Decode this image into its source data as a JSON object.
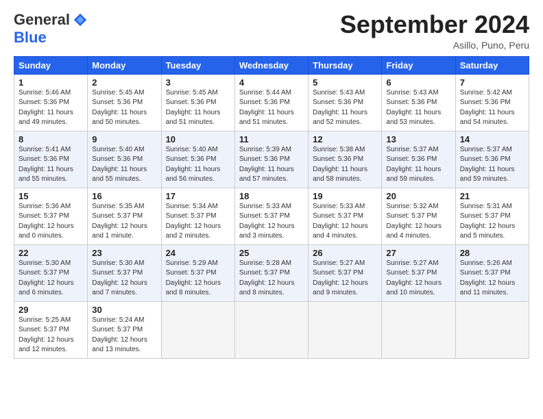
{
  "header": {
    "logo_general": "General",
    "logo_blue": "Blue",
    "month_title": "September 2024",
    "location": "Asillo, Puno, Peru"
  },
  "calendar": {
    "days_of_week": [
      "Sunday",
      "Monday",
      "Tuesday",
      "Wednesday",
      "Thursday",
      "Friday",
      "Saturday"
    ],
    "weeks": [
      [
        {
          "day": "1",
          "sunrise": "5:46 AM",
          "sunset": "5:36 PM",
          "daylight": "11 hours and 49 minutes."
        },
        {
          "day": "2",
          "sunrise": "5:45 AM",
          "sunset": "5:36 PM",
          "daylight": "11 hours and 50 minutes."
        },
        {
          "day": "3",
          "sunrise": "5:45 AM",
          "sunset": "5:36 PM",
          "daylight": "11 hours and 51 minutes."
        },
        {
          "day": "4",
          "sunrise": "5:44 AM",
          "sunset": "5:36 PM",
          "daylight": "11 hours and 51 minutes."
        },
        {
          "day": "5",
          "sunrise": "5:43 AM",
          "sunset": "5:36 PM",
          "daylight": "11 hours and 52 minutes."
        },
        {
          "day": "6",
          "sunrise": "5:43 AM",
          "sunset": "5:36 PM",
          "daylight": "11 hours and 53 minutes."
        },
        {
          "day": "7",
          "sunrise": "5:42 AM",
          "sunset": "5:36 PM",
          "daylight": "11 hours and 54 minutes."
        }
      ],
      [
        {
          "day": "8",
          "sunrise": "5:41 AM",
          "sunset": "5:36 PM",
          "daylight": "11 hours and 55 minutes."
        },
        {
          "day": "9",
          "sunrise": "5:40 AM",
          "sunset": "5:36 PM",
          "daylight": "11 hours and 55 minutes."
        },
        {
          "day": "10",
          "sunrise": "5:40 AM",
          "sunset": "5:36 PM",
          "daylight": "11 hours and 56 minutes."
        },
        {
          "day": "11",
          "sunrise": "5:39 AM",
          "sunset": "5:36 PM",
          "daylight": "11 hours and 57 minutes."
        },
        {
          "day": "12",
          "sunrise": "5:38 AM",
          "sunset": "5:36 PM",
          "daylight": "11 hours and 58 minutes."
        },
        {
          "day": "13",
          "sunrise": "5:37 AM",
          "sunset": "5:36 PM",
          "daylight": "11 hours and 59 minutes."
        },
        {
          "day": "14",
          "sunrise": "5:37 AM",
          "sunset": "5:36 PM",
          "daylight": "11 hours and 59 minutes."
        }
      ],
      [
        {
          "day": "15",
          "sunrise": "5:36 AM",
          "sunset": "5:37 PM",
          "daylight": "12 hours and 0 minutes."
        },
        {
          "day": "16",
          "sunrise": "5:35 AM",
          "sunset": "5:37 PM",
          "daylight": "12 hours and 1 minute."
        },
        {
          "day": "17",
          "sunrise": "5:34 AM",
          "sunset": "5:37 PM",
          "daylight": "12 hours and 2 minutes."
        },
        {
          "day": "18",
          "sunrise": "5:33 AM",
          "sunset": "5:37 PM",
          "daylight": "12 hours and 3 minutes."
        },
        {
          "day": "19",
          "sunrise": "5:33 AM",
          "sunset": "5:37 PM",
          "daylight": "12 hours and 4 minutes."
        },
        {
          "day": "20",
          "sunrise": "5:32 AM",
          "sunset": "5:37 PM",
          "daylight": "12 hours and 4 minutes."
        },
        {
          "day": "21",
          "sunrise": "5:31 AM",
          "sunset": "5:37 PM",
          "daylight": "12 hours and 5 minutes."
        }
      ],
      [
        {
          "day": "22",
          "sunrise": "5:30 AM",
          "sunset": "5:37 PM",
          "daylight": "12 hours and 6 minutes."
        },
        {
          "day": "23",
          "sunrise": "5:30 AM",
          "sunset": "5:37 PM",
          "daylight": "12 hours and 7 minutes."
        },
        {
          "day": "24",
          "sunrise": "5:29 AM",
          "sunset": "5:37 PM",
          "daylight": "12 hours and 8 minutes."
        },
        {
          "day": "25",
          "sunrise": "5:28 AM",
          "sunset": "5:37 PM",
          "daylight": "12 hours and 8 minutes."
        },
        {
          "day": "26",
          "sunrise": "5:27 AM",
          "sunset": "5:37 PM",
          "daylight": "12 hours and 9 minutes."
        },
        {
          "day": "27",
          "sunrise": "5:27 AM",
          "sunset": "5:37 PM",
          "daylight": "12 hours and 10 minutes."
        },
        {
          "day": "28",
          "sunrise": "5:26 AM",
          "sunset": "5:37 PM",
          "daylight": "12 hours and 11 minutes."
        }
      ],
      [
        {
          "day": "29",
          "sunrise": "5:25 AM",
          "sunset": "5:37 PM",
          "daylight": "12 hours and 12 minutes."
        },
        {
          "day": "30",
          "sunrise": "5:24 AM",
          "sunset": "5:37 PM",
          "daylight": "12 hours and 13 minutes."
        },
        null,
        null,
        null,
        null,
        null
      ]
    ]
  }
}
